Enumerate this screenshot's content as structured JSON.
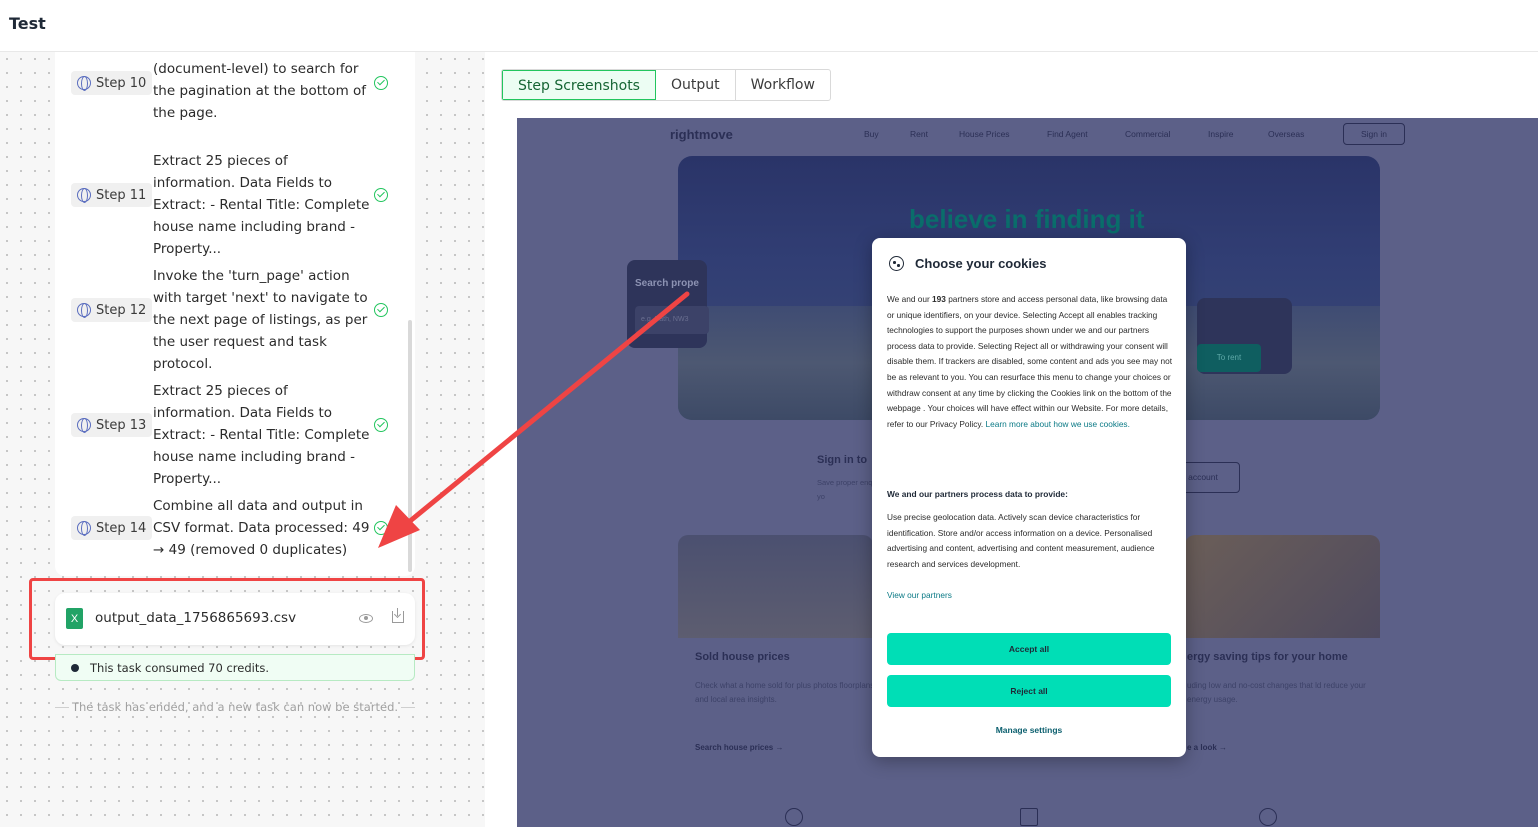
{
  "app": {
    "title": "Test"
  },
  "steps": [
    {
      "label": "Step 10",
      "text": "(document-level) to search for the pagination at the bottom of the page."
    },
    {
      "label": "Step 11",
      "text": "Extract 25 pieces of information. Data Fields to Extract: - Rental Title: Complete house name including brand - Property..."
    },
    {
      "label": "Step 12",
      "text": "Invoke the 'turn_page' action with target 'next' to navigate to the next page of listings, as per the user request and task protocol."
    },
    {
      "label": "Step 13",
      "text": "Extract 25 pieces of information. Data Fields to Extract: - Rental Title: Complete house name including brand - Property..."
    },
    {
      "label": "Step 14",
      "text": "Combine all data and output in CSV format. Data processed: 49 → 49 (removed 0 duplicates)"
    }
  ],
  "file": {
    "name": "output_data_1756865693.csv",
    "icon": "excel-icon",
    "icon_letter": "X"
  },
  "credits": {
    "text": "This task consumed 70 credits."
  },
  "ended": {
    "text": "The task has ended, and a new task can now be started."
  },
  "tabs": [
    {
      "label": "Step Screenshots",
      "active": true
    },
    {
      "label": "Output",
      "active": false
    },
    {
      "label": "Workflow",
      "active": false
    }
  ],
  "website": {
    "logo": "rightmove",
    "nav": [
      "Buy",
      "Rent",
      "House Prices",
      "Find Agent",
      "Commercial",
      "Inspire",
      "Overseas"
    ],
    "signin": "Sign in",
    "hero_title_highlight": "believe",
    "hero_title_rest": " in finding it",
    "search_label": "Search prope",
    "search_placeholder": "e.g. Bath, NW3",
    "to_rent": "To rent",
    "signin_card_title": "Sign in to",
    "signin_card_sub": "Save proper enquiries yo",
    "account_btn": "n account",
    "sold_title": "Sold house prices",
    "sold_sub": "Check what a home sold for plus photos floorplans and local area insights.",
    "sold_link": "Search house prices →",
    "energy_title": "ergy saving tips for your home",
    "energy_sub": "uding low and no-cost changes that ld reduce your energy usage.",
    "energy_link": "e a look →"
  },
  "cookie_modal": {
    "title": "Choose your cookies",
    "body_pre": "We and our ",
    "partners_count": "193",
    "body_post": " partners store and access personal data, like browsing data or unique identifiers, on your device. Selecting Accept all enables tracking technologies to support the purposes shown under we and our partners process data to provide. Selecting Reject all or withdrawing your consent will disable them. If trackers are disabled, some content and ads you see may not be as relevant to you. You can resurface this menu to change your choices or withdraw consent at any time by clicking the Cookies link on the bottom of the webpage . Your choices will have effect within our Website. For more details, refer to our Privacy Policy. ",
    "learn_more": "Learn more about how we use cookies.",
    "subtitle": "We and our partners process data to provide:",
    "body2": "Use precise geolocation data. Actively scan device characteristics for identification. Store and/or access information on a device. Personalised advertising and content, advertising and content measurement, audience research and services development.",
    "view_partners": "View our partners",
    "accept": "Accept all",
    "reject": "Reject all",
    "manage": "Manage settings"
  },
  "colors": {
    "accent_green": "#22c55e",
    "annotation_red": "#ef4444",
    "cookie_button": "#00deb6"
  }
}
